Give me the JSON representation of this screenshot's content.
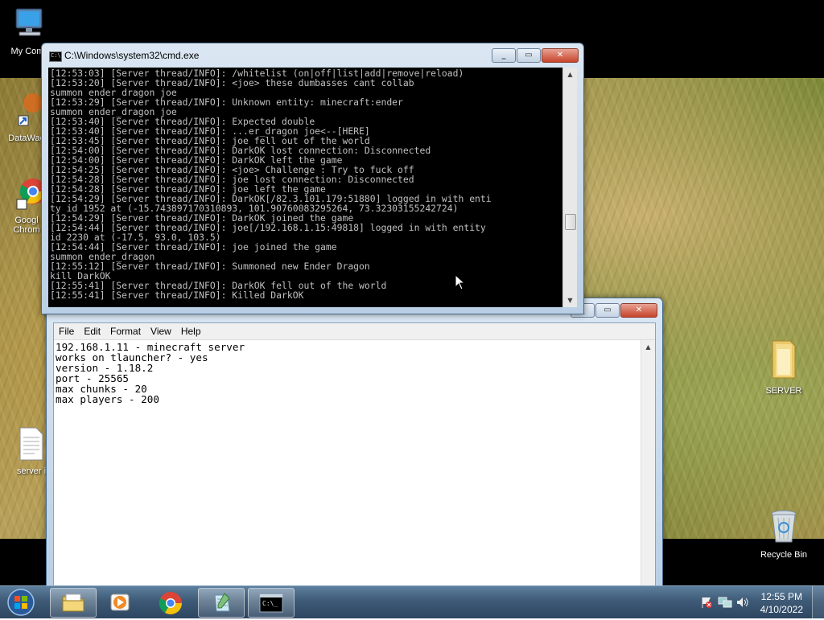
{
  "desktop": {
    "icons": [
      {
        "label": "My Comp",
        "icon": "computer-icon"
      },
      {
        "label": "DataWag",
        "icon": "shortcut-icon"
      },
      {
        "label": "Googl",
        "label2": "Chrom",
        "icon": "chrome-icon"
      },
      {
        "label": "server i",
        "icon": "text-file-icon"
      },
      {
        "label": "SERVER",
        "icon": "folder-icon"
      },
      {
        "label": "Recycle Bin",
        "icon": "recycle-bin-icon"
      }
    ]
  },
  "cmd": {
    "title": "C:\\Windows\\system32\\cmd.exe",
    "lines": [
      "[12:53:03] [Server thread/INFO]: /whitelist (on|off|list|add|remove|reload)",
      "[12:53:20] [Server thread/INFO]: <joe> these dumbasses cant collab",
      "summon ender dragon joe",
      "[12:53:29] [Server thread/INFO]: Unknown entity: minecraft:ender",
      "summon ender_dragon joe",
      "[12:53:40] [Server thread/INFO]: Expected double",
      "[12:53:40] [Server thread/INFO]: ...er_dragon joe<--[HERE]",
      "[12:53:45] [Server thread/INFO]: joe fell out of the world",
      "[12:54:00] [Server thread/INFO]: DarkOK lost connection: Disconnected",
      "[12:54:00] [Server thread/INFO]: DarkOK left the game",
      "[12:54:25] [Server thread/INFO]: <joe> Challenge : Try to fuck off",
      "[12:54:28] [Server thread/INFO]: joe lost connection: Disconnected",
      "[12:54:28] [Server thread/INFO]: joe left the game",
      "[12:54:29] [Server thread/INFO]: DarkOK[/82.3.101.179:51880] logged in with enti",
      "ty id 1952 at (-15.743897170310893, 101.90760083295264, 73.32303155242724)",
      "[12:54:29] [Server thread/INFO]: DarkOK joined the game",
      "[12:54:44] [Server thread/INFO]: joe[/192.168.1.15:49818] logged in with entity",
      "id 2230 at (-17.5, 93.0, 103.5)",
      "[12:54:44] [Server thread/INFO]: joe joined the game",
      "summon ender_dragon",
      "[12:55:12] [Server thread/INFO]: Summoned new Ender Dragon",
      "kill DarkOK",
      "[12:55:41] [Server thread/INFO]: DarkOK fell out of the world",
      "[12:55:41] [Server thread/INFO]: Killed DarkOK"
    ]
  },
  "notepad": {
    "menu": [
      "File",
      "Edit",
      "Format",
      "View",
      "Help"
    ],
    "content": "192.168.1.11 - minecraft server\nworks on tlauncher? - yes\nversion - 1.18.2\nport - 25565\nmax chunks - 20\nmax players - 200"
  },
  "taskbar": {
    "items": [
      "explorer-icon",
      "media-player-icon",
      "chrome-icon",
      "notepad-icon",
      "cmd-icon"
    ],
    "time": "12:55 PM",
    "date": "4/10/2022"
  }
}
